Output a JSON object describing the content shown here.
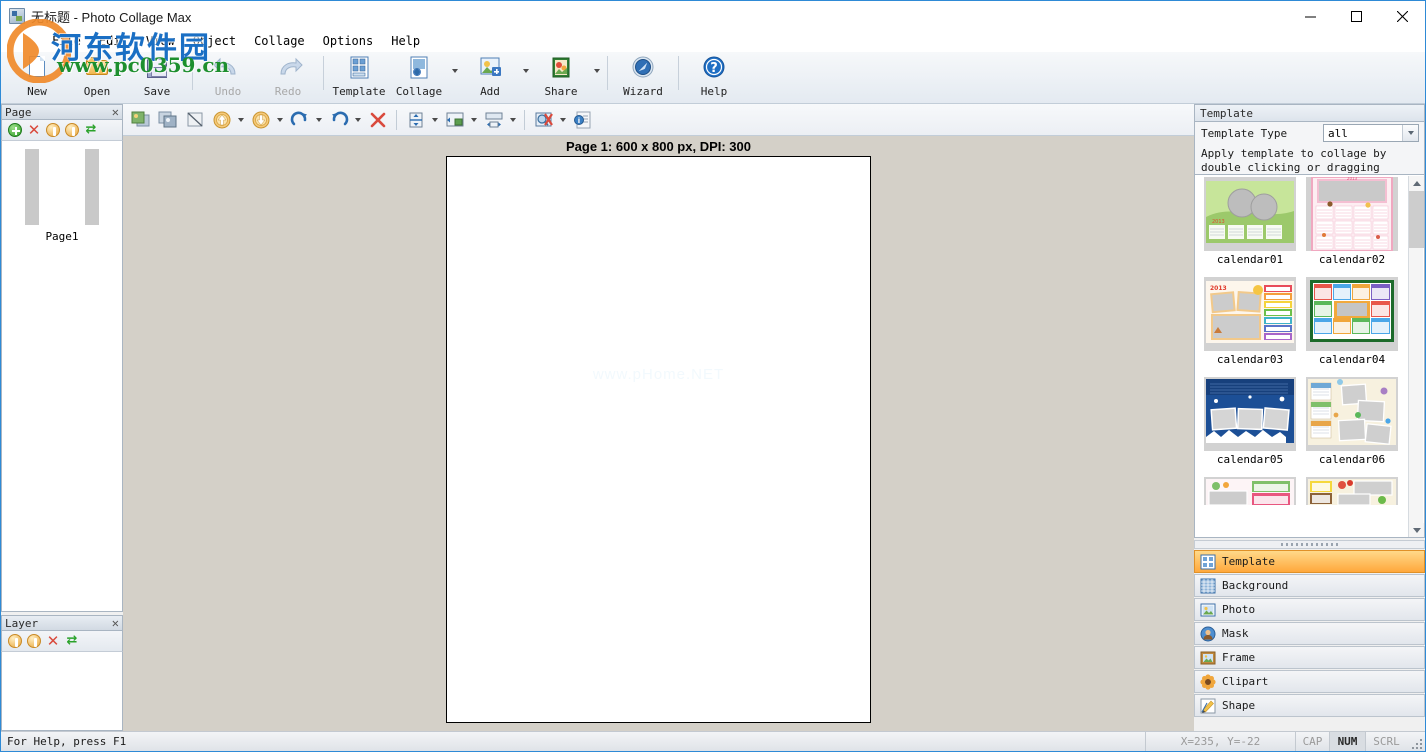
{
  "window": {
    "title": "无标题 - Photo Collage Max",
    "icon": "app-icon",
    "minimize": "—",
    "maximize": "□",
    "close": "✕"
  },
  "menu": {
    "items": [
      {
        "label": "File"
      },
      {
        "label": "Edit"
      },
      {
        "label": "View"
      },
      {
        "label": "Object"
      },
      {
        "label": "Collage"
      },
      {
        "label": "Options"
      },
      {
        "label": "Help"
      }
    ]
  },
  "toolbar": {
    "buttons": [
      {
        "label": "New",
        "icon": "new-document-icon",
        "enabled": true,
        "dropdown": false
      },
      {
        "label": "Open",
        "icon": "open-folder-icon",
        "enabled": true,
        "dropdown": false
      },
      {
        "label": "Save",
        "icon": "save-floppy-icon",
        "enabled": true,
        "dropdown": false
      },
      {
        "label": "Undo",
        "icon": "undo-arrow-icon",
        "enabled": false,
        "dropdown": false
      },
      {
        "label": "Redo",
        "icon": "redo-arrow-icon",
        "enabled": false,
        "dropdown": false
      },
      {
        "label": "Template",
        "icon": "template-grid-icon",
        "enabled": true,
        "dropdown": false
      },
      {
        "label": "Collage",
        "icon": "collage-icon",
        "enabled": true,
        "dropdown": true
      },
      {
        "label": "Add",
        "icon": "add-photo-icon",
        "enabled": true,
        "dropdown": true
      },
      {
        "label": "Share",
        "icon": "share-book-icon",
        "enabled": true,
        "dropdown": true
      },
      {
        "label": "Wizard",
        "icon": "wizard-compass-icon",
        "enabled": true,
        "dropdown": false
      },
      {
        "label": "Help",
        "icon": "help-question-icon",
        "enabled": true,
        "dropdown": false
      }
    ]
  },
  "toolbar2": {
    "buttons": [
      {
        "name": "bring-to-front-icon",
        "dropdown": false
      },
      {
        "name": "send-to-back-icon",
        "dropdown": false
      },
      {
        "name": "crop-icon",
        "dropdown": false
      },
      {
        "name": "move-up-icon",
        "dropdown": true
      },
      {
        "name": "move-down-icon",
        "dropdown": true
      },
      {
        "name": "rotate-right-icon",
        "dropdown": true
      },
      {
        "name": "rotate-left-icon",
        "dropdown": true
      },
      {
        "name": "delete-icon",
        "dropdown": false
      },
      {
        "name": "align-vertical-icon",
        "dropdown": true
      },
      {
        "name": "align-horizontal-icon",
        "dropdown": true
      },
      {
        "name": "size-match-icon",
        "dropdown": true
      },
      {
        "name": "zoom-remove-icon",
        "dropdown": true
      },
      {
        "name": "properties-info-icon",
        "dropdown": false
      }
    ]
  },
  "page_panel": {
    "title": "Page",
    "close": "✕",
    "tools": [
      {
        "name": "add-page-icon"
      },
      {
        "name": "delete-page-icon"
      },
      {
        "name": "move-page-up-icon"
      },
      {
        "name": "move-page-down-icon"
      },
      {
        "name": "refresh-page-icon"
      }
    ],
    "thumbnail_label": "Page1"
  },
  "layer_panel": {
    "title": "Layer",
    "close": "✕",
    "tools": [
      {
        "name": "layer-up-icon"
      },
      {
        "name": "layer-down-icon"
      },
      {
        "name": "delete-layer-icon"
      },
      {
        "name": "refresh-layer-icon"
      }
    ]
  },
  "canvas": {
    "page_title": "Page 1: 600 x 800 px, DPI: 300",
    "watermark": "www.pHome.NET"
  },
  "template_panel": {
    "title": "Template",
    "type_label": "Template Type",
    "type_value": "all",
    "type_options": [
      "all"
    ],
    "hint_line1": "Apply template to collage by",
    "hint_line2": "double clicking or dragging",
    "templates": [
      {
        "name": "calendar01",
        "style": "leaf-green"
      },
      {
        "name": "calendar02",
        "style": "pink-frame"
      },
      {
        "name": "calendar03",
        "style": "cream-horse"
      },
      {
        "name": "calendar04",
        "style": "dark-green-grid"
      },
      {
        "name": "calendar05",
        "style": "blue-snow"
      },
      {
        "name": "calendar06",
        "style": "cream-scatter"
      },
      {
        "name": "",
        "style": "pastel-partial"
      },
      {
        "name": "",
        "style": "yellow-partial"
      }
    ]
  },
  "categories": {
    "items": [
      {
        "label": "Template",
        "icon": "template-grid-icon",
        "active": true
      },
      {
        "label": "Background",
        "icon": "background-icon",
        "active": false
      },
      {
        "label": "Photo",
        "icon": "photo-icon",
        "active": false
      },
      {
        "label": "Mask",
        "icon": "mask-icon",
        "active": false
      },
      {
        "label": "Frame",
        "icon": "frame-icon",
        "active": false
      },
      {
        "label": "Clipart",
        "icon": "clipart-flower-icon",
        "active": false
      },
      {
        "label": "Shape",
        "icon": "shape-pencil-icon",
        "active": false
      }
    ]
  },
  "statusbar": {
    "help_text": "For Help, press F1",
    "coords": "X=235, Y=-22",
    "cap": "CAP",
    "num": "NUM",
    "scrl": "SCRL"
  },
  "overlay_watermark": {
    "chinese": "河东软件园",
    "url": "www.pc0359.cn"
  },
  "colors": {
    "accent_orange": "#ffa83c",
    "title_blue": "#1a6fc4",
    "url_green": "#1d8f2e",
    "canvas_bg": "#d4d0c8",
    "window_border": "#2e8ad6"
  }
}
